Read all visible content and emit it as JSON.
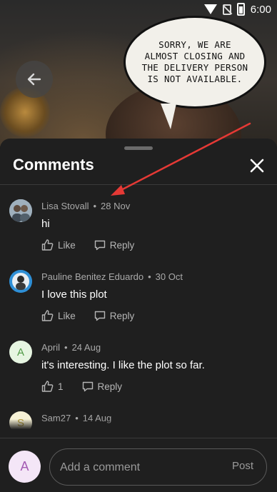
{
  "status_bar": {
    "time": "6:00",
    "icons": [
      "signal-icon",
      "no-sim-icon",
      "battery-icon"
    ]
  },
  "comic": {
    "speech_bubble": "SORRY, WE ARE ALMOST CLOSING AND THE DELIVERY PERSON IS NOT AVAILABLE."
  },
  "sheet": {
    "title": "Comments",
    "close_icon": "close-icon"
  },
  "comments": [
    {
      "author": "Lisa Stovall",
      "date": "28 Nov",
      "text": "hi",
      "like_label": "Like",
      "reply_label": "Reply",
      "avatar": "photo",
      "avatar_color": "#8a9aa8"
    },
    {
      "author": "Pauline Benitez Eduardo",
      "date": "30 Oct",
      "text": "I love this plot",
      "like_label": "Like",
      "reply_label": "Reply",
      "avatar": "photo",
      "avatar_color": "#2e8fd6"
    },
    {
      "author": "April",
      "date": "24 Aug",
      "text": "it's interesting. I like the plot so far.",
      "like_label": "1",
      "reply_label": "Reply",
      "avatar": "A",
      "avatar_color": "#e6f5e1",
      "avatar_text_color": "#4f9a45"
    },
    {
      "author": "Sam27",
      "date": "14 Aug",
      "text": "",
      "like_label": "",
      "reply_label": "",
      "avatar": "S",
      "avatar_color": "#f7f2d6",
      "avatar_text_color": "#b9a03a"
    }
  ],
  "composer": {
    "avatar": "A",
    "placeholder": "Add a comment",
    "post_label": "Post"
  },
  "colors": {
    "sheet_bg": "#1f1f1f",
    "annotation_arrow": "#e53935"
  }
}
